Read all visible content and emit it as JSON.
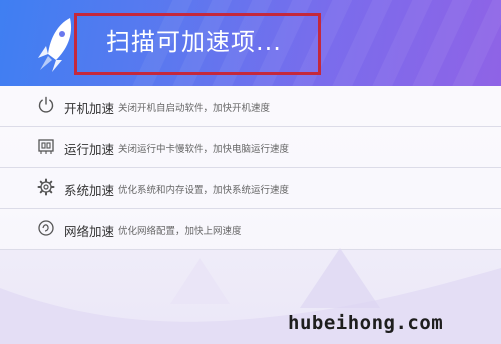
{
  "header": {
    "scan_text": "扫描可加速项...",
    "highlight_color": "#c4283c"
  },
  "items": [
    {
      "icon": "power-icon",
      "name": "开机加速",
      "desc": "关闭开机自启动软件，加快开机速度"
    },
    {
      "icon": "memory-chip-icon",
      "name": "运行加速",
      "desc": "关闭运行中卡慢软件，加快电脑运行速度"
    },
    {
      "icon": "gear-icon",
      "name": "系统加速",
      "desc": "优化系统和内存设置，加快系统运行速度"
    },
    {
      "icon": "network-icon",
      "name": "网络加速",
      "desc": "优化网络配置，加快上网速度"
    }
  ],
  "watermark": "hubeihong.com"
}
